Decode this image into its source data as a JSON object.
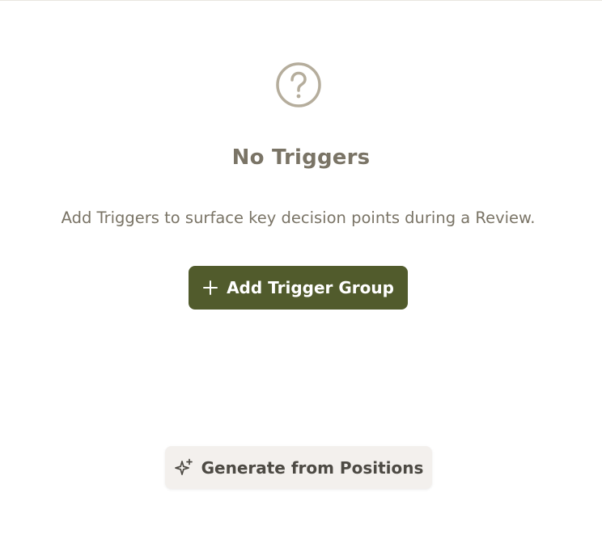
{
  "empty_state": {
    "icon": "question-circle-icon",
    "title": "No Triggers",
    "description": "Add Triggers to surface key decision points during a Review.",
    "add_button_icon": "plus-icon",
    "add_button_label": "Add Trigger Group",
    "generate_button_icon": "sparkle-icon",
    "generate_button_label": "Generate from Positions"
  },
  "colors": {
    "primary_button": "#515b2c",
    "secondary_button": "#f3f0ed",
    "muted_text": "#7a7466",
    "icon": "#b5ad9c"
  }
}
